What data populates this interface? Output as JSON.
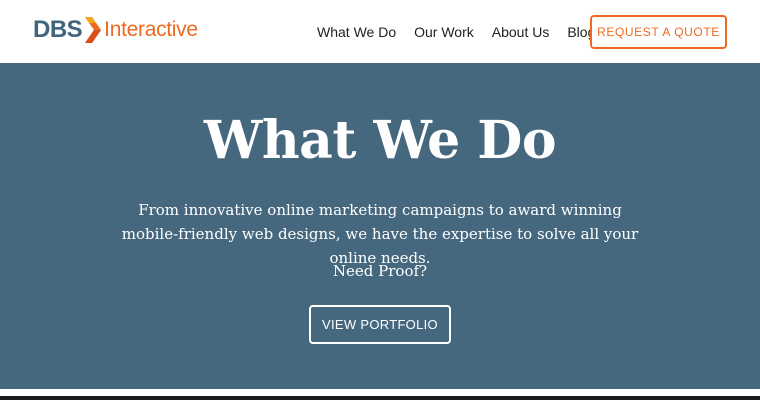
{
  "header": {
    "logo": {
      "primary": "DBS",
      "secondary": "Interactive"
    },
    "nav": [
      {
        "label": "What We Do"
      },
      {
        "label": "Our Work"
      },
      {
        "label": "About Us"
      },
      {
        "label": "Blog"
      }
    ],
    "cta_label": "REQUEST A QUOTE"
  },
  "hero": {
    "title": "What We Do",
    "description": "From innovative online marketing campaigns to award winning mobile-friendly web designs, we have the expertise to solve all your online needs.",
    "proof_text": "Need Proof?",
    "button_label": "VIEW PORTFOLIO"
  },
  "colors": {
    "brand_blue": "#41647f",
    "brand_orange": "#ee6a20",
    "hero_background": "#46687e"
  }
}
